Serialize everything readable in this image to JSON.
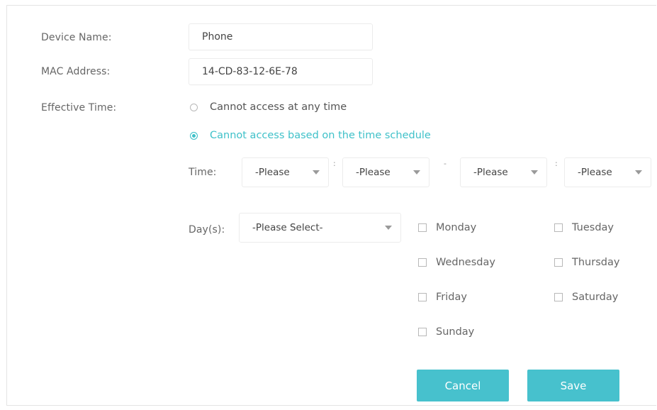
{
  "form": {
    "device_name_label": "Device Name:",
    "device_name_value": "Phone",
    "mac_label": "MAC Address:",
    "mac_value": "14-CD-83-12-6E-78",
    "effective_time_label": "Effective Time:",
    "options": [
      {
        "label": "Cannot access at any time",
        "selected": false
      },
      {
        "label": "Cannot access based on the time schedule",
        "selected": true
      }
    ],
    "time_label": "Time:",
    "time_selects": [
      "-Please",
      "-Please",
      "-Please",
      "-Please"
    ],
    "time_separators": [
      ":",
      "-",
      ":"
    ],
    "days_label": "Day(s):",
    "days_select": "-Please Select-",
    "days": [
      "Monday",
      "Tuesday",
      "Wednesday",
      "Thursday",
      "Friday",
      "Saturday",
      "Sunday"
    ],
    "cancel_label": "Cancel",
    "save_label": "Save"
  },
  "colors": {
    "accent": "#47c1cd",
    "selected_text": "#3fc1c9",
    "label_text": "#666666"
  },
  "icons": [
    "radio-icon",
    "checkbox-icon",
    "dropdown-caret-icon"
  ]
}
